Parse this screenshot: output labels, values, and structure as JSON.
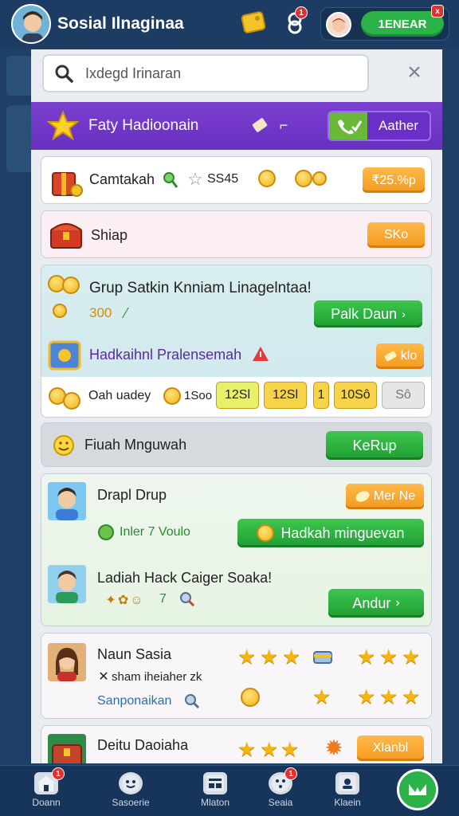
{
  "header": {
    "title": "Sosial Ilnaginaa",
    "subtitle": "",
    "notif_badge": "1",
    "action_button": "1ENEAR",
    "action_badge": "x"
  },
  "search": {
    "placeholder": "Ixdegd Irinaran",
    "close": "×"
  },
  "banner": {
    "title": "Faty Hadioonain",
    "button": "Aather"
  },
  "row1": {
    "label": "Camtakah",
    "stars": "SS45",
    "price": "₹25.%p"
  },
  "row2": {
    "label": "Shiap",
    "price": "SKo"
  },
  "group": {
    "title": "Grup Satkin Knniam Linagelntaa!",
    "amount": "300",
    "join_button": "Palk Daun",
    "highlight": "Hadkaihnl Pralensemah",
    "highlight_button": "klo",
    "daily_label": "Oah uadey",
    "daily_value": "1Soo",
    "chips": [
      "12Sl",
      "12Sl",
      "1",
      "10Sô",
      "Sô"
    ]
  },
  "section": {
    "title": "Fiuah Mnguwah",
    "button": "KeRup"
  },
  "friends": [
    {
      "name": "Drapl Drup",
      "sub": "Inler 7 Voulo",
      "button": "Mer Ne",
      "action": "Hadkah minguevan"
    },
    {
      "name": "Ladiah Hack Caiger Soaka!",
      "sub": "7",
      "action": "Andur"
    }
  ],
  "players": [
    {
      "name": "Naun Sasia",
      "sub": "sham iheiaher zk",
      "sub2": "Sanponaikan"
    },
    {
      "name": "Deitu Daoiaha",
      "button": "Xlanbl"
    }
  ],
  "nav": {
    "items": [
      "Doann",
      "Sasoerie",
      "Mlaton",
      "Seaia",
      "Klaein"
    ],
    "badges": [
      "1",
      "1"
    ]
  },
  "colors": {
    "primary": "#1c3c64",
    "purple": "#6f34c8",
    "green": "#2bb34a",
    "orange": "#f5a02a"
  }
}
